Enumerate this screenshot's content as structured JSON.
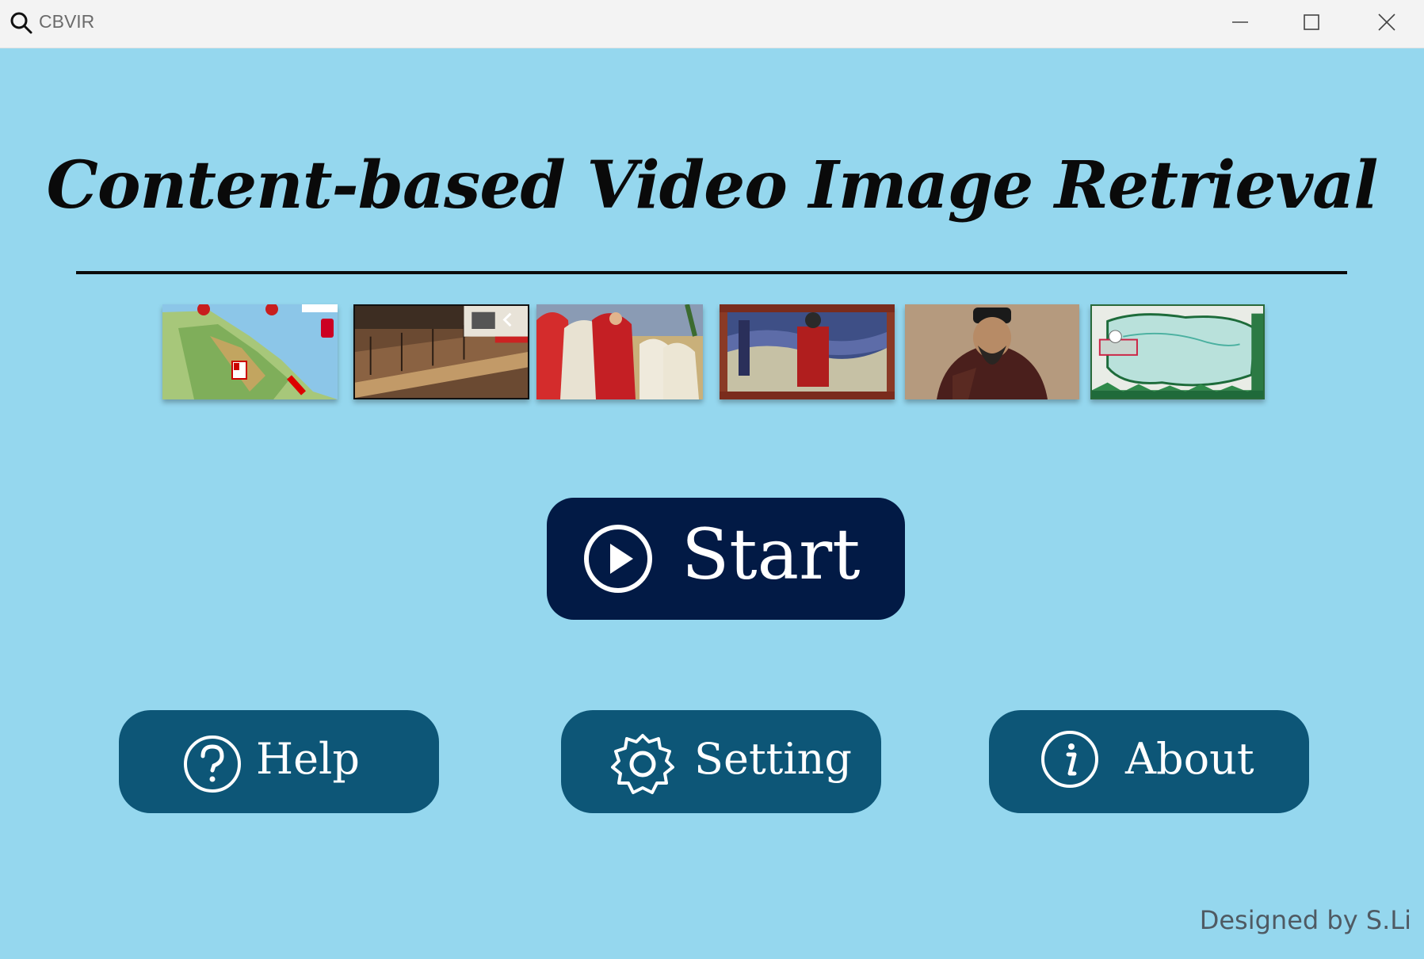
{
  "window": {
    "title": "CBVIR",
    "controls": [
      "minimize",
      "maximize",
      "close"
    ]
  },
  "main": {
    "heading": "Content-based Video Image Retrieval",
    "thumbnails": [
      {
        "name": "map-italy-thumbnail"
      },
      {
        "name": "harbor-illustration-thumbnail"
      },
      {
        "name": "painting-cardinals-thumbnail"
      },
      {
        "name": "portrait-tapestry-thumbnail"
      },
      {
        "name": "emperor-portrait-thumbnail"
      },
      {
        "name": "green-map-thumbnail"
      }
    ],
    "start_label": "Start",
    "help_label": "Help",
    "setting_label": "Setting",
    "about_label": "About",
    "credit": "Designed by S.Li"
  },
  "colors": {
    "background": "#95d7ee",
    "start_button": "#021a45",
    "secondary_button": "#0d5677",
    "button_text": "#ffffff"
  }
}
